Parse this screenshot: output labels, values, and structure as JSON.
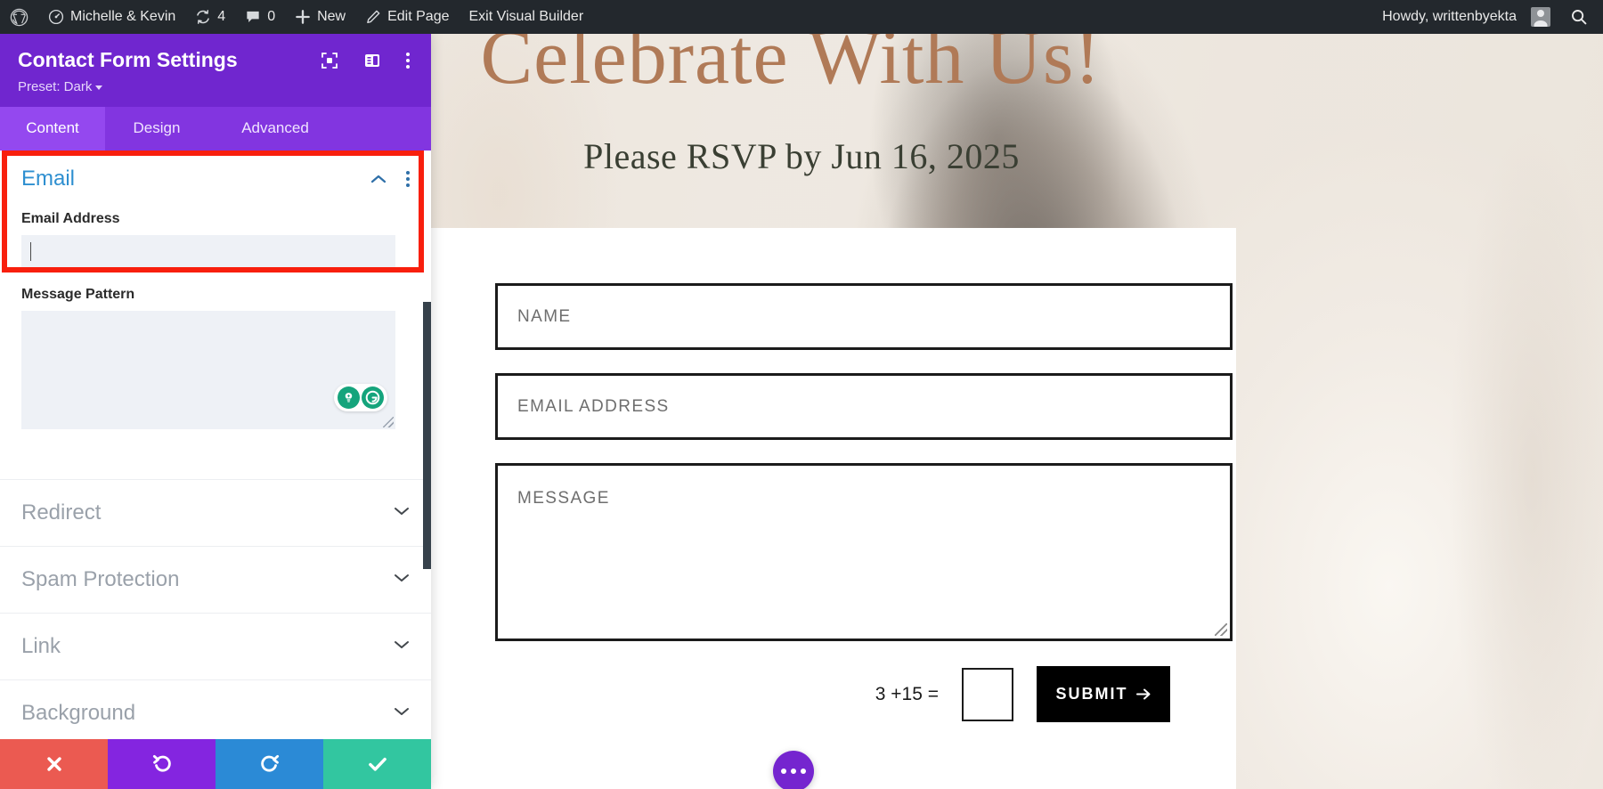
{
  "adminbar": {
    "wp_logo": "wordpress-logo-icon",
    "items": [
      {
        "name": "site-name",
        "icon": "dashboard-icon",
        "label": "Michelle & Kevin"
      },
      {
        "name": "updates",
        "icon": "update-arrows-icon",
        "label": "4"
      },
      {
        "name": "comments",
        "icon": "comment-bubble-icon",
        "label": "0"
      },
      {
        "name": "new-content",
        "icon": "plus-icon",
        "label": "New"
      },
      {
        "name": "edit-page",
        "icon": "pencil-icon",
        "label": "Edit Page"
      },
      {
        "name": "exit-visual-builder",
        "icon": "",
        "label": "Exit Visual Builder"
      }
    ],
    "howdy": "Howdy, writtenbyekta",
    "search_icon": "search-icon"
  },
  "panel": {
    "title": "Contact Form Settings",
    "preset_label": "Preset: Dark",
    "head_icons": [
      {
        "name": "responsive-preview-icon",
        "icon": "focus-frame-icon"
      },
      {
        "name": "panel-layout-icon",
        "icon": "layout-columns-icon"
      },
      {
        "name": "panel-more-icon",
        "icon": "kebab-menu-icon"
      }
    ],
    "tabs": [
      {
        "label": "Content",
        "active": true
      },
      {
        "label": "Design",
        "active": false
      },
      {
        "label": "Advanced",
        "active": false
      }
    ],
    "open_section": {
      "title": "Email",
      "collapse_icon": "chevron-up-icon",
      "more_icon": "kebab-menu-icon",
      "fields": [
        {
          "label": "Email Address",
          "value": "",
          "type": "text"
        },
        {
          "label": "Message Pattern",
          "value": "",
          "type": "textarea"
        }
      ],
      "assistant_icons": [
        {
          "name": "grammarly-suggestion-icon",
          "glyph": "lightbulb-icon"
        },
        {
          "name": "grammarly-logo-icon",
          "glyph": "G"
        }
      ]
    },
    "closed_sections": [
      {
        "label": "Redirect",
        "icon": "chevron-down-icon"
      },
      {
        "label": "Spam Protection",
        "icon": "chevron-down-icon"
      },
      {
        "label": "Link",
        "icon": "chevron-down-icon"
      },
      {
        "label": "Background",
        "icon": "chevron-down-icon"
      }
    ],
    "footer_buttons": [
      {
        "name": "discard-button",
        "icon": "close-x-icon",
        "color": "#eb5a51"
      },
      {
        "name": "undo-button",
        "icon": "undo-arrow-icon",
        "color": "#8425e0"
      },
      {
        "name": "redo-button",
        "icon": "redo-arrow-icon",
        "color": "#2b8ad6"
      },
      {
        "name": "save-button",
        "icon": "checkmark-icon",
        "color": "#32c6a0"
      }
    ]
  },
  "page": {
    "hero_title": "Celebrate With Us!",
    "hero_subtitle": "Please RSVP by Jun 16, 2025",
    "form": {
      "fields": [
        {
          "name": "name-field",
          "placeholder": "NAME"
        },
        {
          "name": "email-address-field",
          "placeholder": "EMAIL ADDRESS"
        },
        {
          "name": "message-field",
          "placeholder": "MESSAGE"
        }
      ],
      "captcha_question": "3 +15 =",
      "captcha_value": "",
      "submit_label": "SUBMIT",
      "submit_arrow": "arrow-right-icon"
    },
    "fab": {
      "name": "page-settings-fab",
      "icon": "ellipsis-icon"
    }
  },
  "colors": {
    "panel_purple": "#7026cf",
    "tab_active": "#9448ef",
    "highlight_red": "#f81f0d",
    "section_open_blue": "#2e8fd0",
    "hero_title_color": "#b07a57",
    "grammarly_green": "#15a47c"
  }
}
